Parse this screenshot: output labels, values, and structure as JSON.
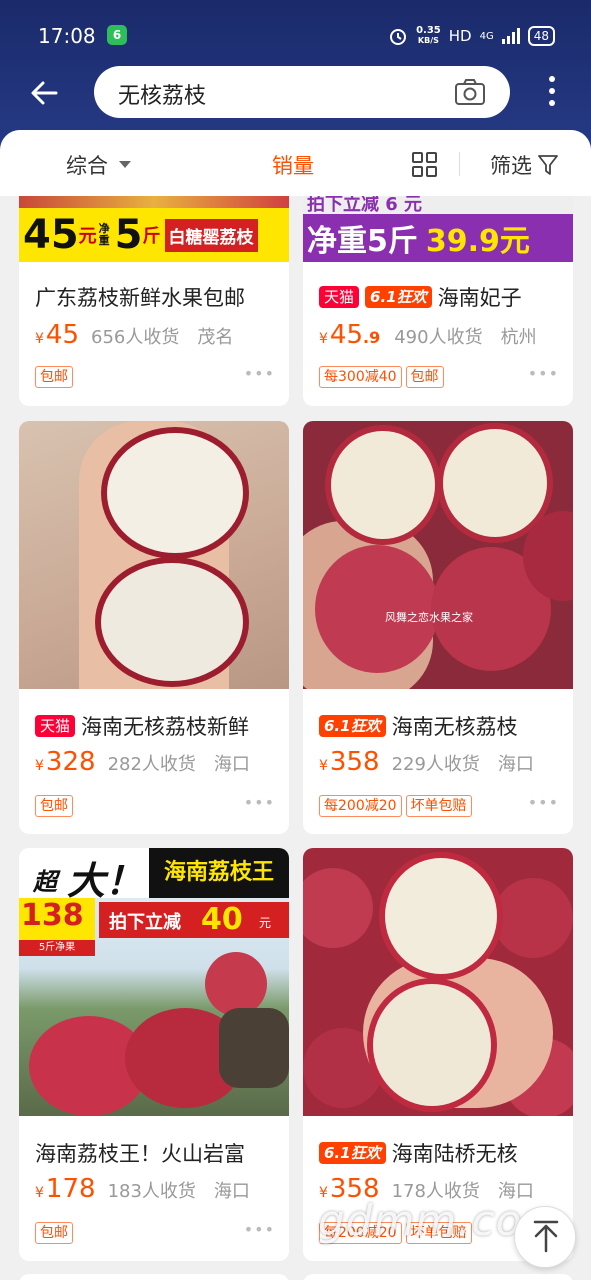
{
  "status_bar": {
    "time": "17:08",
    "app_badge": "6",
    "speed_value": "0.35",
    "speed_unit": "KB/S",
    "hd": "HD",
    "net": "4G",
    "battery": "48"
  },
  "search": {
    "query": "无核荔枝"
  },
  "sort_bar": {
    "comprehensive": "综合",
    "sales": "销量",
    "filter": "筛选"
  },
  "colors": {
    "accent": "#ff5000",
    "header": "#1f3078"
  },
  "icons": [
    "back-arrow-icon",
    "camera-icon",
    "more-vertical-icon",
    "dropdown-triangle-icon",
    "grid-view-icon",
    "filter-funnel-icon",
    "back-to-top-icon"
  ],
  "products": [
    {
      "title": "广东荔枝新鲜水果包邮",
      "badges": [],
      "currency": "¥",
      "price": "45",
      "sold": "656人收货",
      "location": "茂名",
      "tags": [
        "包邮"
      ],
      "banner": {
        "big1": "45",
        "unit1": "元",
        "mid": "净重",
        "big2": "5",
        "unit2": "斤",
        "text": "白糖罂荔枝"
      }
    },
    {
      "title": "海南妃子",
      "badges": [
        "天猫",
        "6.1狂欢"
      ],
      "currency": "¥",
      "price": "45",
      "price_decimal": ".9",
      "sold": "490人收货",
      "location": "杭州",
      "tags": [
        "每300减40",
        "包邮"
      ],
      "banner": {
        "top": "拍下立减 6 元",
        "main": "净重5斤",
        "price": "39.9元"
      }
    },
    {
      "title": "海南无核荔枝新鲜",
      "badges": [
        "天猫"
      ],
      "currency": "¥",
      "price": "328",
      "sold": "282人收货",
      "location": "海口",
      "tags": [
        "包邮"
      ]
    },
    {
      "title": "海南无核荔枝",
      "badges": [
        "6.1狂欢"
      ],
      "currency": "¥",
      "price": "358",
      "sold": "229人收货",
      "location": "海口",
      "tags": [
        "每200减20",
        "坏单包赔"
      ],
      "image_caption": "风舞之恋水果之家"
    },
    {
      "title": "海南荔枝王！火山岩富",
      "badges": [],
      "currency": "¥",
      "price": "178",
      "sold": "183人收货",
      "location": "海口",
      "tags": [
        "包邮"
      ],
      "banner": {
        "chao": "超",
        "da": "大！",
        "name": "海南荔枝王",
        "price": "138",
        "price_sub": "5斤净果",
        "cut": "拍下立减",
        "cut_num": "40",
        "cut_unit": "元"
      }
    },
    {
      "title": "海南陆桥无核",
      "badges": [
        "6.1狂欢"
      ],
      "currency": "¥",
      "price": "358",
      "sold": "178人收货",
      "location": "海口",
      "tags": [
        "每200减20",
        "坏单包赔"
      ]
    }
  ],
  "watermark": "gdmm.com"
}
